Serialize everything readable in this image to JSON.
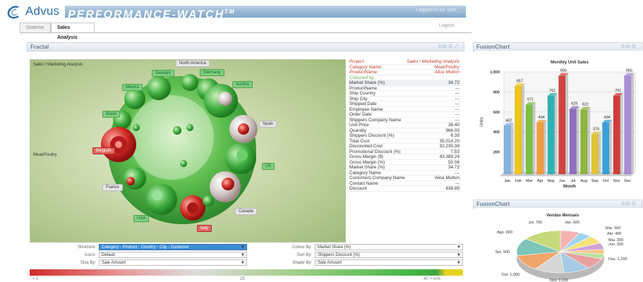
{
  "header": {
    "brand": "Advus",
    "product": "PERFORMANCE-WATCH",
    "tm": "TM",
    "logged_in": "Logged in as: user_",
    "logout": "Logout"
  },
  "tabs": [
    {
      "label": "Sisteme",
      "active": false
    },
    {
      "label": "Sales Analysis",
      "active": true
    }
  ],
  "fractal_panel": {
    "title": "Fractal",
    "actions": "Edit"
  },
  "fractal": {
    "subtitle": "Sales / Marketing Analysis",
    "center_top_label": "North America",
    "labels": [
      {
        "text": "Sweden",
        "kind": "g"
      },
      {
        "text": "Germany",
        "kind": "g"
      },
      {
        "text": "Mexico",
        "kind": "g"
      },
      {
        "text": "Austria",
        "kind": "g"
      },
      {
        "text": "Brazil",
        "kind": "g"
      },
      {
        "text": "Spain",
        "kind": "w"
      },
      {
        "text": "Belgium",
        "kind": "r"
      },
      {
        "text": "Meat/Poultry",
        "kind": "t"
      },
      {
        "text": "UK",
        "kind": "g"
      },
      {
        "text": "France",
        "kind": "w"
      },
      {
        "text": "Canada",
        "kind": "w"
      },
      {
        "text": "USA",
        "kind": "g"
      },
      {
        "text": "Italy",
        "kind": "r"
      }
    ]
  },
  "attributes": [
    {
      "k": "Project:",
      "v": "Sales / Marketing Analysis",
      "style": "red"
    },
    {
      "k": "Category Name:",
      "v": "Meat/Poultry",
      "style": "red"
    },
    {
      "k": "ProductName:",
      "v": "Alice Mutton",
      "style": "red"
    },
    {
      "k": "Coloured by:",
      "v": "",
      "style": "grn"
    },
    {
      "k": "Market Share (%)",
      "v": "34.72",
      "style": "hdr"
    },
    {
      "k": "ProductName",
      "v": "---",
      "style": ""
    },
    {
      "k": "Ship Country",
      "v": "---",
      "style": ""
    },
    {
      "k": "Ship City",
      "v": "---",
      "style": ""
    },
    {
      "k": "Shipped Date",
      "v": "---",
      "style": ""
    },
    {
      "k": "Employee Name",
      "v": "---",
      "style": ""
    },
    {
      "k": "Order Date",
      "v": "---",
      "style": ""
    },
    {
      "k": "Shippers Company Name",
      "v": "---",
      "style": ""
    },
    {
      "k": "Unit Price",
      "v": "36.40",
      "style": ""
    },
    {
      "k": "Quantity",
      "v": "966.00",
      "style": ""
    },
    {
      "k": "Shippers Discount (%)",
      "v": "6.39",
      "style": ""
    },
    {
      "k": "Total Cost",
      "v": "35,014.20",
      "style": ""
    },
    {
      "k": "Discounted Cost",
      "v": "32,230.38",
      "style": ""
    },
    {
      "k": "Promotional Discount (%)",
      "v": "7.53",
      "style": ""
    },
    {
      "k": "Gross Margin ($)",
      "v": "43,389.24",
      "style": ""
    },
    {
      "k": "Gross Margin (%)",
      "v": "50.06",
      "style": ""
    },
    {
      "k": "Market Share (%)",
      "v": "34.72",
      "style": ""
    },
    {
      "k": "Category Name",
      "v": "---",
      "style": ""
    },
    {
      "k": "Customers Company Name",
      "v": "Alice Mutton",
      "style": ""
    },
    {
      "k": "Contact Name",
      "v": "---",
      "style": ""
    },
    {
      "k": "Discount",
      "v": "638.89",
      "style": ""
    }
  ],
  "controls": {
    "structure_label": "Structure:",
    "structure_value": "Category - Product - Country - City - Customer",
    "icons_label": "Icons:",
    "icons_value": "Default",
    "size_label": "Size By:",
    "size_value": "Sale Amount",
    "colour_label": "Colour By:",
    "colour_value": "Market Share (%)",
    "sort_label": "Sort By:",
    "sort_value": "Shippers Discount (%)",
    "shade_label": "Shade By:",
    "shade_value": "Sale Amount"
  },
  "colorbar": {
    "min": "< 2",
    "mid": "25",
    "max": "40 > %%"
  },
  "chart_panel_1": {
    "title": "FusionChart",
    "actions": "Edit"
  },
  "chart_panel_2": {
    "title": "FusionChart",
    "actions": "Edit"
  },
  "chart_data": [
    {
      "type": "bar",
      "title": "Monthly Unit Sales",
      "xlabel": "Month",
      "ylabel": "Units",
      "categories": [
        "Jan",
        "Feb",
        "Mar",
        "Apr",
        "May",
        "Jun",
        "Jul",
        "Aug",
        "Sep",
        "Oct",
        "Nov",
        "Dec"
      ],
      "values": [
        462,
        857,
        671,
        494,
        761,
        960,
        629,
        622,
        376,
        494,
        761,
        960
      ],
      "ylim": [
        0,
        1000
      ],
      "yticks": [
        200,
        400,
        600,
        800,
        1000
      ],
      "ytick_labels": [
        "200",
        "400",
        "600",
        "800",
        "1,000"
      ],
      "colors": [
        "#7fb3e0",
        "#f0c419",
        "#7bc043",
        "#f39c3b",
        "#2bb3b3",
        "#d0453b",
        "#8e6fc1",
        "#8db83a",
        "#e0c431",
        "#3aa0d8",
        "#d13b3b",
        "#a98ed6"
      ]
    },
    {
      "type": "pie",
      "title": "Vendas Mensais",
      "labels": [
        "Jan. 600",
        "Fev. 400",
        "Mar. 500",
        "Abr. 400",
        "Mai. 300",
        "Jun. 200",
        "Jul. 700",
        "Ago. 800",
        "Set. 900",
        "Out. 1,000",
        "Nov. 1,100",
        "Dez. 1,200"
      ],
      "visible_labels": [
        "Jul. 700",
        "Jan. 600",
        "Mar. 500",
        "Abr. 400",
        "Mai. 300",
        "Jun. 300",
        "Ago. 800",
        "Set. 900",
        "Out. 1,000",
        "Dez. 1,200",
        "Nov. 1,100"
      ],
      "values": [
        600,
        400,
        500,
        400,
        300,
        300,
        700,
        800,
        900,
        1000,
        1100,
        1200
      ],
      "colors": [
        "#f6b3b3",
        "#9fd4ef",
        "#f4e27a",
        "#cfa3d6",
        "#f7c68a",
        "#b7e29d",
        "#e9a0a0",
        "#a7cbe6",
        "#d6d6d6",
        "#f0a56a",
        "#7cc5b8",
        "#c6d97a"
      ]
    }
  ]
}
